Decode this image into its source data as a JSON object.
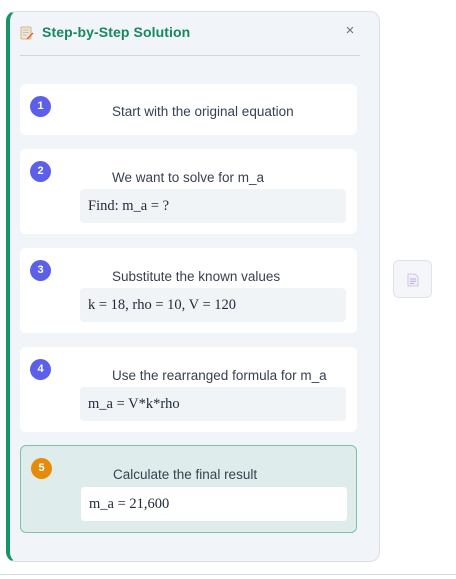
{
  "panel": {
    "title": "Step-by-Step Solution",
    "close_label": "×",
    "accent_color": "#169467",
    "icons": {
      "header": "memo-pencil-icon",
      "close": "close-icon",
      "side": "document-icon"
    }
  },
  "steps": [
    {
      "number": "1",
      "title": "Start with the original equation",
      "formula": ""
    },
    {
      "number": "2",
      "title": "We want to solve for m_a",
      "formula": "Find: m_a = ?"
    },
    {
      "number": "3",
      "title": "Substitute the known values",
      "formula": "k = 18, rho = 10, V = 120"
    },
    {
      "number": "4",
      "title": "Use the rearranged formula for m_a",
      "formula": "m_a = V*k*rho"
    },
    {
      "number": "5",
      "title": "Calculate the final result",
      "formula": "m_a = 21,600",
      "active": true
    }
  ],
  "colors": {
    "step_badge": "#5b5fe9",
    "active_badge": "#e58b08",
    "active_bg": "#deedeb"
  }
}
